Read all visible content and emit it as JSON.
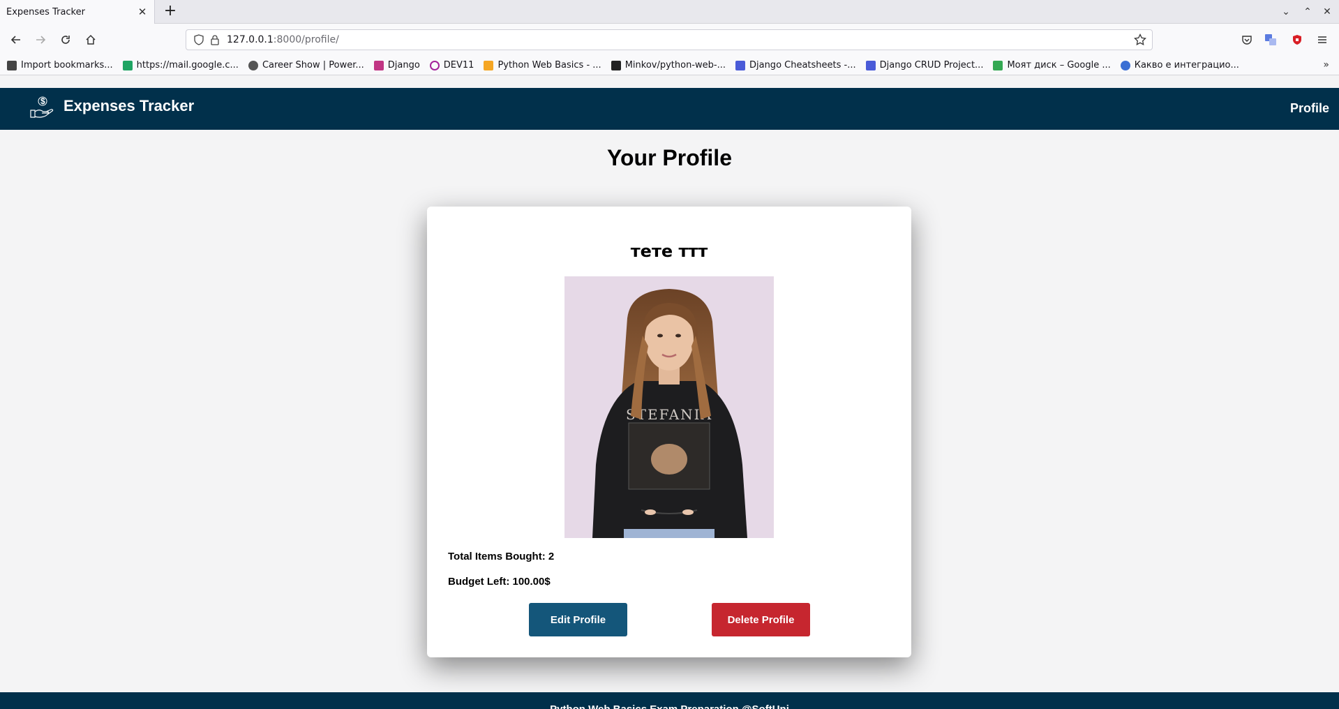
{
  "browser": {
    "tab_title": "Expenses Tracker",
    "url_host": "127.0.0.1",
    "url_rest": ":8000/profile/",
    "bookmarks": [
      {
        "label": "Import bookmarks...",
        "icon": "import-icon",
        "color": "#444444"
      },
      {
        "label": "https://mail.google.c...",
        "icon": "google-chat-icon",
        "color": "#1fa463"
      },
      {
        "label": "Career Show | Power...",
        "icon": "globe-icon",
        "color": "#555555"
      },
      {
        "label": "Django",
        "icon": "instagram-icon",
        "color": "#c13584"
      },
      {
        "label": "DEV11",
        "icon": "ring-icon",
        "color": "#a3229a"
      },
      {
        "label": "Python Web Basics - ...",
        "icon": "softuni-icon",
        "color": "#f5a623"
      },
      {
        "label": "Minkov/python-web-...",
        "icon": "github-icon",
        "color": "#222222"
      },
      {
        "label": "Django Cheatsheets -...",
        "icon": "doc-icon",
        "color": "#4a5bd8"
      },
      {
        "label": "Django CRUD Project...",
        "icon": "doc-icon",
        "color": "#4a5bd8"
      },
      {
        "label": "Моят диск – Google ...",
        "icon": "google-drive-icon",
        "color": "#34a853"
      },
      {
        "label": "Какво е интеграцио...",
        "icon": "globe-color-icon",
        "color": "#3b6fd4"
      }
    ]
  },
  "site": {
    "title": "Expenses Tracker",
    "nav_profile": "Profile",
    "footer": "Python Web Basics Exam Preparation @SoftUni"
  },
  "page": {
    "heading": "Your Profile",
    "name": "тете ттт",
    "photo_alt": "profile photo",
    "total_items_label": "Total Items Bought: 2",
    "budget_label": "Budget Left: 100.00$",
    "edit_button": "Edit Profile",
    "delete_button": "Delete Profile"
  },
  "colors": {
    "header_bg": "#01304b",
    "edit_bg": "#14567a",
    "delete_bg": "#c6262f",
    "page_bg": "#f4f4f5"
  }
}
